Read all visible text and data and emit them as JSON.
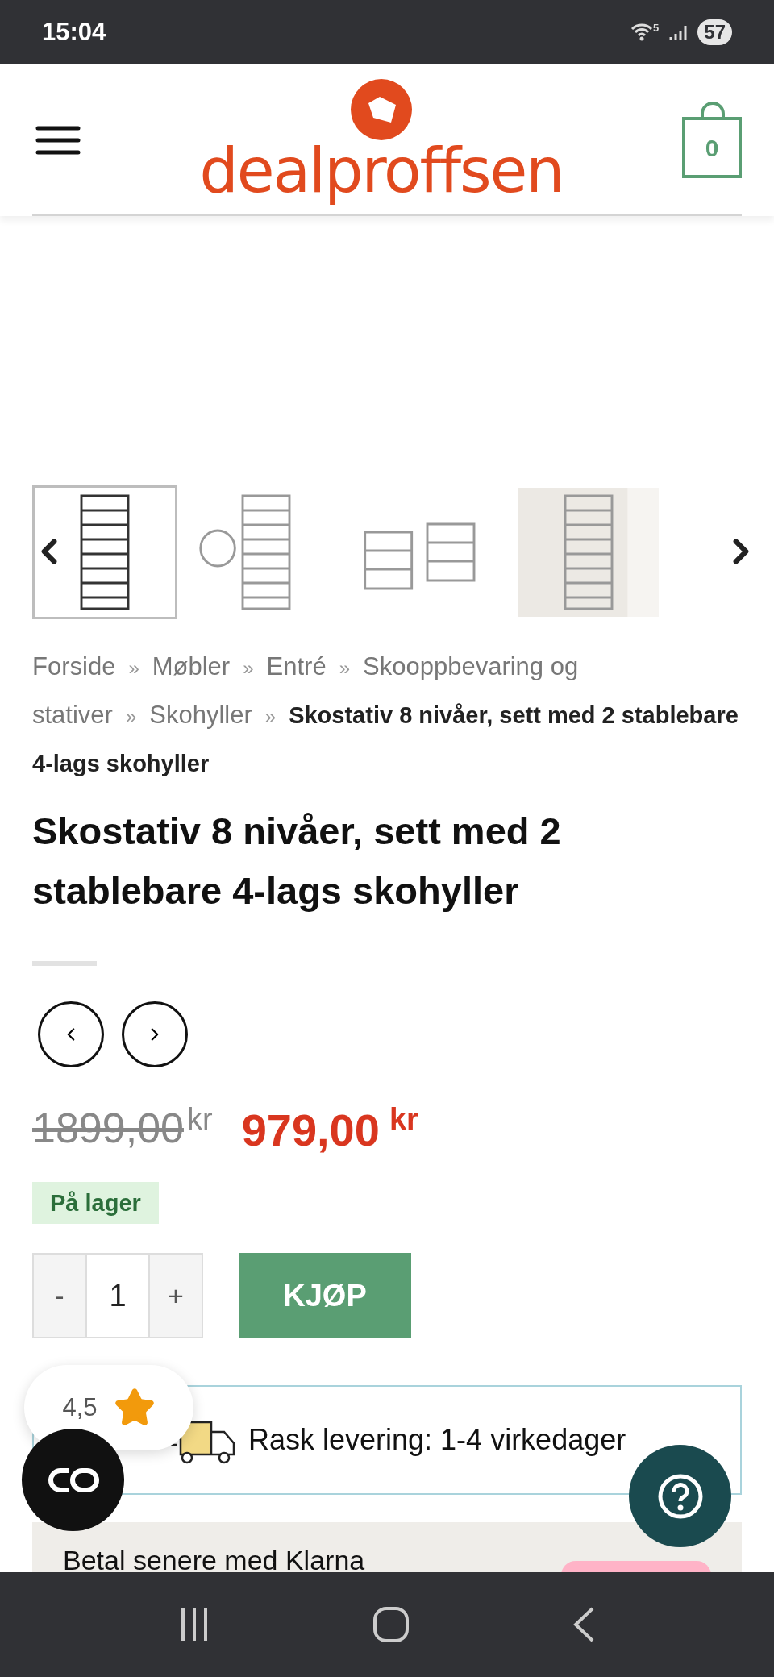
{
  "status_bar": {
    "time": "15:04",
    "wifi_badge": "5",
    "battery": "57"
  },
  "header": {
    "logo": "dealproffsen",
    "cart_count": "0"
  },
  "gallery": {
    "thumbnails": [
      {
        "kind": "picture",
        "selected": true
      },
      {
        "kind": "picture",
        "selected": false
      },
      {
        "kind": "picture",
        "selected": false
      },
      {
        "kind": "picture",
        "selected": false
      }
    ]
  },
  "breadcrumb": [
    {
      "label": "Forside",
      "current": false
    },
    {
      "separator": "»",
      "label": "Møbler",
      "current": false
    },
    {
      "separator": "»",
      "label": "Entré",
      "current": false
    },
    {
      "separator": "»",
      "label": "Skooppbevaring og stativer",
      "current": false
    },
    {
      "separator": "»",
      "label": "Skohyller",
      "current": false
    },
    {
      "separator": "»",
      "label": "Skostativ 8 nivåer, sett med 2 stablebare 4-lags skohyller",
      "current": true
    }
  ],
  "product": {
    "title": "Skostativ 8 nivåer, sett med 2 stablebare 4-lags skohyller",
    "old_price": {
      "amount": "1899,00",
      "currency": "kr"
    },
    "price": {
      "amount": "979,00",
      "currency": "kr"
    },
    "stock": {
      "label": "På lager",
      "in_stock": true
    },
    "quantity": {
      "minus": "-",
      "value": "1",
      "plus": "+"
    },
    "buy_button": "KJØP",
    "delivery": "Rask levering: 1-4 virkedager",
    "klarna": "Betal senere med Klarna"
  },
  "rating": "4,5"
}
